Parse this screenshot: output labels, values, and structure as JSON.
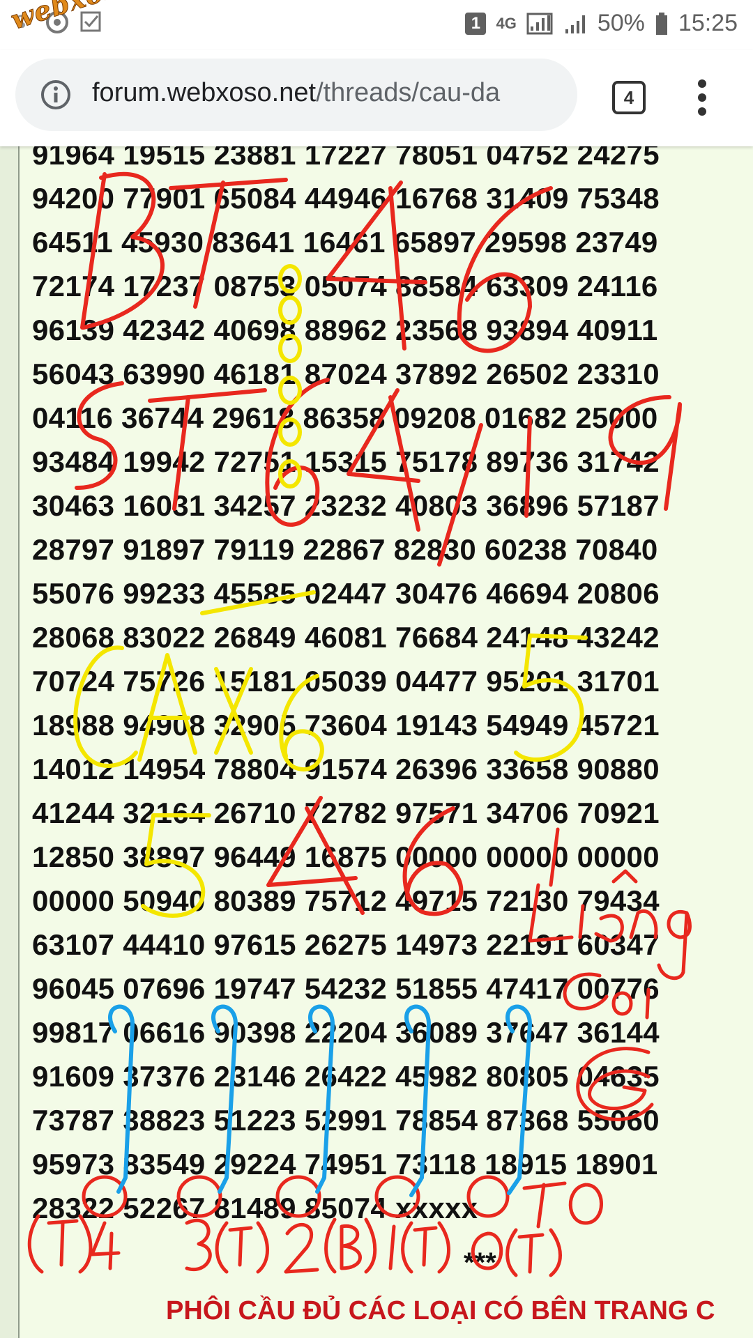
{
  "status_bar": {
    "battery": "50%",
    "time": "15:25",
    "network": "4G",
    "notification_badge": "1",
    "watermark_text": "webxoso.net"
  },
  "browser": {
    "url_host": "forum.webxoso.net",
    "url_path": "/threads/cau-da",
    "tab_count": "4"
  },
  "results": [
    "91964 19515 23881 17227 78051 04752 24275",
    "94200 77901 65084 44946 16768 31409 75348",
    "64511 45930 83641 16461 65897 29598 23749",
    "72174 17237 08753 05074 88584 63309 24116",
    "96139 42342 40698 88962 23568 93894 40911",
    "56043 63990 46181 87024 37892 26502 23310",
    "04116 36744 29618 86358 09208 01682 25000",
    "93484 19942 72751 15315 75178 89736 31742",
    "30463 16031 34257 23232 40803 36896 57187",
    "28797 91897 79119 22867 82830 60238 70840",
    "55076 99233 45585 02447 30476 46694 20806",
    "28068 83022 26849 46081 76684 24148 43242",
    "70724 75726 15181 05039 04477 95201 31701",
    "18988 94908 32905 73604 19143 54949 45721",
    "14012 14954 78804 91574 26396 33658 90880",
    "41244 32164 26710 72782 97571 34706 70921",
    "12850 38897 96449 16875 00000 00000 00000",
    "00000 50940 80389 75712 49715 72130 79434",
    "63107 44410 97615 26275 14973 22191 60347",
    "96045 07696 19747 54232 51855 47417 00776",
    "99817 06616 90398 22204 36089 37647 36144",
    "91609 37376 23146 26422 45982 80805 04635",
    "73787 38823 51223 52991 78854 87368 55060",
    "95973 83549 29224 74951 73118 18915 18901",
    "28322 52267 81489 85074 xxxxx"
  ],
  "annotations": {
    "red": [
      "BT 46",
      "ST 64/19",
      "546",
      "Liêng",
      "Cối",
      "G",
      "(T)4",
      "3(T)",
      "2(B)",
      "1(T)",
      "0(T)",
      "TO"
    ],
    "yellow": [
      "CAX 6",
      "5"
    ]
  },
  "footer": {
    "stars": "***",
    "title": "PHÔI CẦU ĐỦ CÁC LOẠI CÓ BÊN TRANG C"
  },
  "colors": {
    "page_bg": "#f3fbe7",
    "ink_red": "#e8281e",
    "ink_yellow": "#f4e600",
    "ink_blue": "#1aa0e8",
    "footer_red": "#c7161c"
  }
}
